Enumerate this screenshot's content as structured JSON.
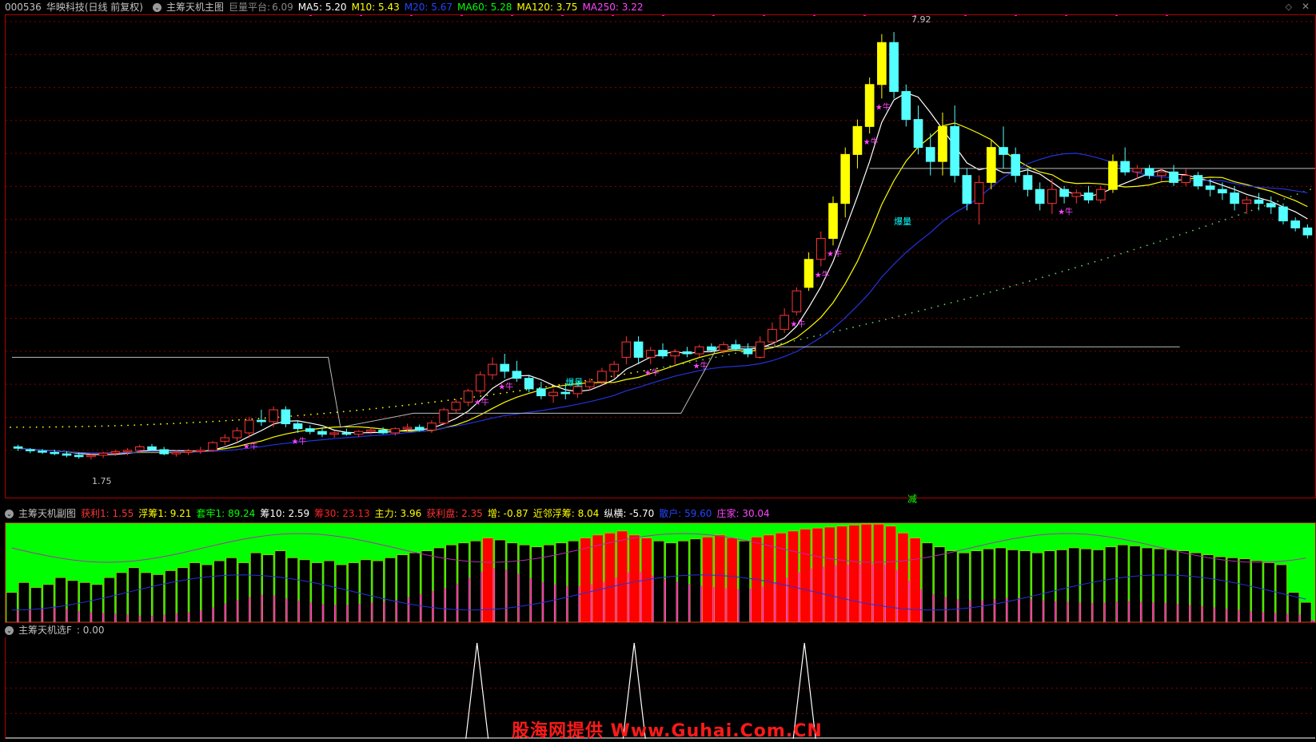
{
  "main_header": {
    "code": "000536",
    "name": "华映科技(日线 前复权)",
    "indicator": "主筹天机主图",
    "platform_label": "巨量平台:",
    "platform_value": "6.09",
    "ma": [
      {
        "label": "MA5:",
        "value": "5.20",
        "color": "#ffffff"
      },
      {
        "label": "M10:",
        "value": "5.43",
        "color": "#ffff00"
      },
      {
        "label": "M20:",
        "value": "5.67",
        "color": "#2244ff"
      },
      {
        "label": "MA60:",
        "value": "5.28",
        "color": "#00ff00"
      },
      {
        "label": "MA120:",
        "value": "3.75",
        "color": "#ffff00"
      },
      {
        "label": "MA250:",
        "value": "3.22",
        "color": "#ff44ff"
      }
    ]
  },
  "main_labels": {
    "high_price": "7.92",
    "low_price": "1.75",
    "jian": "减",
    "star_text": "★牛",
    "vol_text": "爆量"
  },
  "sub_header": {
    "name": "主筹天机副图",
    "items": [
      {
        "label": "获利1:",
        "value": "1.55",
        "color": "#ff3333"
      },
      {
        "label": "浮筹1:",
        "value": "9.21",
        "color": "#ffff00"
      },
      {
        "label": "套牢1:",
        "value": "89.24",
        "color": "#00ff00"
      },
      {
        "label": "筹10:",
        "value": "2.59",
        "color": "#ffffff"
      },
      {
        "label": "筹30:",
        "value": "23.13",
        "color": "#ff2222"
      },
      {
        "label": "主力:",
        "value": "3.96",
        "color": "#ffff00"
      },
      {
        "label": "获利盘:",
        "value": "2.35",
        "color": "#ff3333"
      },
      {
        "label": "增:",
        "value": "-0.87",
        "color": "#ffff00"
      },
      {
        "label": "近邻浮筹:",
        "value": "8.04",
        "color": "#ffff00"
      },
      {
        "label": "纵横:",
        "value": "-5.70",
        "color": "#ffffff"
      },
      {
        "label": "散户:",
        "value": "59.60",
        "color": "#2244ff"
      },
      {
        "label": "庄家:",
        "value": "30.04",
        "color": "#ff44ff"
      }
    ]
  },
  "select_header": {
    "name": "主筹天机选F",
    "value": ": 0.00"
  },
  "watermark": "股海网提供 Www.Guhai.Com.CN",
  "colors": {
    "up": "#ff3333",
    "down": "#54ffff",
    "volume_up": "#ffff00",
    "profit": "#ff00ff",
    "trap": "#00ff00",
    "grid": "#8b0000"
  },
  "chart_data": {
    "type": "candlestick",
    "ylim": [
      1.5,
      8.1
    ],
    "candles": [
      [
        2.02,
        2.05,
        1.96,
        2.0
      ],
      [
        1.98,
        2.0,
        1.93,
        1.97
      ],
      [
        1.96,
        1.99,
        1.92,
        1.95
      ],
      [
        1.94,
        1.98,
        1.9,
        1.93
      ],
      [
        1.92,
        1.96,
        1.87,
        1.9
      ],
      [
        1.9,
        1.94,
        1.85,
        1.88
      ],
      [
        1.88,
        1.92,
        1.84,
        1.9
      ],
      [
        1.9,
        1.95,
        1.86,
        1.93
      ],
      [
        1.93,
        1.98,
        1.89,
        1.95
      ],
      [
        1.95,
        2.0,
        1.9,
        1.97
      ],
      [
        1.97,
        2.05,
        1.93,
        2.02
      ],
      [
        2.02,
        2.06,
        1.96,
        1.98
      ],
      [
        1.98,
        2.02,
        1.9,
        1.92
      ],
      [
        1.92,
        1.97,
        1.88,
        1.94
      ],
      [
        1.94,
        1.99,
        1.9,
        1.96
      ],
      [
        1.96,
        2.02,
        1.92,
        1.97
      ],
      [
        1.97,
        2.1,
        1.95,
        2.08
      ],
      [
        2.1,
        2.2,
        2.05,
        2.15
      ],
      [
        2.15,
        2.3,
        2.1,
        2.25
      ],
      [
        2.22,
        2.45,
        2.15,
        2.4
      ],
      [
        2.4,
        2.55,
        2.32,
        2.38
      ],
      [
        2.38,
        2.6,
        2.3,
        2.55
      ],
      [
        2.55,
        2.6,
        2.3,
        2.35
      ],
      [
        2.35,
        2.4,
        2.22,
        2.28
      ],
      [
        2.28,
        2.33,
        2.2,
        2.24
      ],
      [
        2.24,
        2.3,
        2.16,
        2.2
      ],
      [
        2.2,
        2.25,
        2.15,
        2.22
      ],
      [
        2.22,
        2.28,
        2.18,
        2.2
      ],
      [
        2.2,
        2.26,
        2.16,
        2.24
      ],
      [
        2.24,
        2.3,
        2.2,
        2.26
      ],
      [
        2.26,
        2.3,
        2.2,
        2.22
      ],
      [
        2.22,
        2.3,
        2.18,
        2.28
      ],
      [
        2.28,
        2.35,
        2.24,
        2.3
      ],
      [
        2.3,
        2.34,
        2.24,
        2.26
      ],
      [
        2.26,
        2.4,
        2.22,
        2.36
      ],
      [
        2.36,
        2.58,
        2.33,
        2.55
      ],
      [
        2.55,
        2.7,
        2.5,
        2.66
      ],
      [
        2.66,
        2.85,
        2.6,
        2.82
      ],
      [
        2.82,
        3.1,
        2.78,
        3.05
      ],
      [
        3.05,
        3.3,
        2.98,
        3.2
      ],
      [
        3.2,
        3.35,
        3.0,
        3.1
      ],
      [
        3.1,
        3.25,
        2.95,
        3.0
      ],
      [
        3.0,
        3.05,
        2.8,
        2.85
      ],
      [
        2.85,
        2.95,
        2.7,
        2.75
      ],
      [
        2.75,
        2.85,
        2.65,
        2.8
      ],
      [
        2.8,
        2.9,
        2.7,
        2.78
      ],
      [
        2.78,
        2.92,
        2.72,
        2.88
      ],
      [
        2.88,
        3.0,
        2.82,
        2.95
      ],
      [
        2.95,
        3.15,
        2.9,
        3.1
      ],
      [
        3.1,
        3.25,
        3.0,
        3.2
      ],
      [
        3.3,
        3.6,
        3.2,
        3.52
      ],
      [
        3.52,
        3.6,
        3.2,
        3.3
      ],
      [
        3.3,
        3.45,
        3.2,
        3.4
      ],
      [
        3.4,
        3.5,
        3.28,
        3.32
      ],
      [
        3.32,
        3.42,
        3.2,
        3.38
      ],
      [
        3.38,
        3.45,
        3.3,
        3.35
      ],
      [
        3.35,
        3.48,
        3.3,
        3.45
      ],
      [
        3.45,
        3.5,
        3.38,
        3.4
      ],
      [
        3.4,
        3.52,
        3.35,
        3.48
      ],
      [
        3.48,
        3.55,
        3.4,
        3.42
      ],
      [
        3.42,
        3.5,
        3.3,
        3.35
      ],
      [
        3.3,
        3.6,
        3.28,
        3.52
      ],
      [
        3.52,
        3.8,
        3.48,
        3.7
      ],
      [
        3.7,
        4.0,
        3.65,
        3.9
      ],
      [
        3.95,
        4.3,
        3.9,
        4.25
      ],
      [
        4.3,
        4.8,
        4.25,
        4.7
      ],
      [
        4.7,
        5.1,
        4.6,
        5.0
      ],
      [
        5.0,
        5.6,
        4.9,
        5.5
      ],
      [
        5.5,
        6.3,
        5.3,
        6.2
      ],
      [
        6.2,
        6.7,
        6.0,
        6.6
      ],
      [
        6.6,
        7.3,
        6.5,
        7.2
      ],
      [
        7.2,
        7.92,
        7.0,
        7.8
      ],
      [
        7.8,
        7.95,
        7.0,
        7.1
      ],
      [
        7.1,
        7.2,
        6.6,
        6.7
      ],
      [
        6.7,
        6.9,
        6.2,
        6.3
      ],
      [
        6.3,
        6.5,
        5.9,
        6.1
      ],
      [
        6.1,
        6.8,
        5.9,
        6.6
      ],
      [
        6.6,
        6.9,
        5.8,
        5.9
      ],
      [
        5.9,
        6.0,
        5.4,
        5.5
      ],
      [
        5.5,
        5.9,
        5.2,
        5.8
      ],
      [
        5.8,
        6.4,
        5.7,
        6.3
      ],
      [
        6.3,
        6.6,
        6.0,
        6.2
      ],
      [
        6.2,
        6.3,
        5.8,
        5.9
      ],
      [
        5.9,
        6.0,
        5.6,
        5.7
      ],
      [
        5.7,
        5.8,
        5.4,
        5.5
      ],
      [
        5.5,
        5.85,
        5.35,
        5.7
      ],
      [
        5.7,
        5.75,
        5.5,
        5.6
      ],
      [
        5.6,
        5.7,
        5.5,
        5.65
      ],
      [
        5.65,
        5.75,
        5.5,
        5.55
      ],
      [
        5.55,
        5.75,
        5.5,
        5.7
      ],
      [
        5.7,
        6.2,
        5.65,
        6.1
      ],
      [
        6.1,
        6.3,
        5.9,
        5.95
      ],
      [
        5.95,
        6.05,
        5.85,
        6.0
      ],
      [
        6.0,
        6.05,
        5.85,
        5.9
      ],
      [
        5.9,
        6.0,
        5.82,
        5.95
      ],
      [
        5.95,
        6.05,
        5.75,
        5.8
      ],
      [
        5.8,
        6.0,
        5.75,
        5.9
      ],
      [
        5.9,
        5.95,
        5.7,
        5.75
      ],
      [
        5.75,
        5.85,
        5.6,
        5.7
      ],
      [
        5.7,
        5.8,
        5.55,
        5.65
      ],
      [
        5.65,
        5.75,
        5.4,
        5.5
      ],
      [
        5.5,
        5.6,
        5.35,
        5.55
      ],
      [
        5.55,
        5.65,
        5.4,
        5.5
      ],
      [
        5.5,
        5.6,
        5.35,
        5.45
      ],
      [
        5.45,
        5.5,
        5.2,
        5.25
      ],
      [
        5.25,
        5.3,
        5.1,
        5.15
      ],
      [
        5.15,
        5.2,
        5.0,
        5.05
      ]
    ],
    "sub_bars": [
      30,
      40,
      35,
      38,
      45,
      42,
      40,
      38,
      45,
      50,
      55,
      50,
      48,
      52,
      55,
      60,
      58,
      62,
      65,
      60,
      70,
      68,
      72,
      65,
      63,
      60,
      62,
      58,
      60,
      63,
      62,
      65,
      68,
      70,
      72,
      75,
      78,
      80,
      82,
      85,
      83,
      80,
      78,
      76,
      78,
      80,
      82,
      85,
      88,
      90,
      92,
      88,
      85,
      82,
      80,
      82,
      84,
      86,
      88,
      85,
      82,
      86,
      88,
      90,
      92,
      94,
      95,
      96,
      97,
      98,
      99,
      99,
      97,
      90,
      85,
      80,
      76,
      72,
      70,
      72,
      74,
      75,
      73,
      72,
      70,
      72,
      73,
      75,
      74,
      73,
      76,
      78,
      77,
      75,
      74,
      73,
      72,
      70,
      68,
      66,
      65,
      64,
      62,
      60,
      58,
      30,
      20
    ],
    "sub_profit": [
      18,
      20,
      22,
      24,
      25,
      20,
      18,
      16,
      15,
      14,
      12,
      10,
      12,
      14,
      16,
      18,
      22,
      28,
      35,
      40,
      45,
      48,
      42,
      38,
      35,
      32,
      30,
      28,
      30,
      32,
      34,
      36,
      40,
      45,
      50,
      55,
      60,
      70,
      80,
      90,
      92,
      85,
      78,
      70,
      65,
      62,
      60,
      62,
      66,
      70,
      80,
      88,
      82,
      75,
      70,
      66,
      62,
      60,
      58,
      56,
      55,
      58,
      62,
      70,
      80,
      88,
      92,
      95,
      97,
      98,
      98,
      98,
      96,
      80,
      60,
      50,
      45,
      40,
      38,
      36,
      38,
      40,
      42,
      40,
      38,
      36,
      35,
      34,
      33,
      32,
      34,
      36,
      35,
      34,
      33,
      32,
      30,
      28,
      26,
      24,
      22,
      20,
      18,
      16,
      15,
      14,
      12
    ],
    "signals_x": [
      0.36,
      0.48,
      0.61
    ]
  }
}
